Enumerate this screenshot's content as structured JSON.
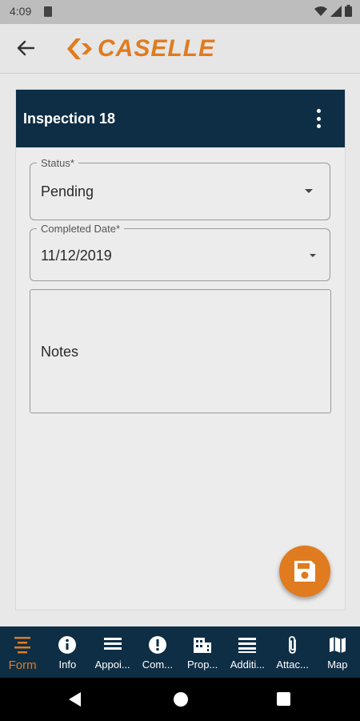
{
  "status_bar": {
    "time": "4:09"
  },
  "app_bar": {
    "logo_text": "CASELLE",
    "brand_color": "#e07b1f"
  },
  "card": {
    "title": "Inspection 18",
    "status_field": {
      "label": "Status*",
      "value": "Pending"
    },
    "date_field": {
      "label": "Completed Date*",
      "value": "11/12/2019"
    },
    "notes_field": {
      "placeholder": "Notes"
    }
  },
  "bottom_nav": {
    "items": [
      {
        "label": "Form",
        "icon": "form-icon",
        "active": true
      },
      {
        "label": "Info",
        "icon": "info-icon"
      },
      {
        "label": "Appoi...",
        "icon": "list-icon"
      },
      {
        "label": "Com...",
        "icon": "alert-icon"
      },
      {
        "label": "Prop...",
        "icon": "building-icon"
      },
      {
        "label": "Additi...",
        "icon": "list-icon"
      },
      {
        "label": "Attac...",
        "icon": "paperclip-icon"
      },
      {
        "label": "Map",
        "icon": "map-icon"
      }
    ]
  },
  "colors": {
    "header": "#0e2e45",
    "accent": "#e07b1f",
    "background": "#e8e8e8"
  }
}
